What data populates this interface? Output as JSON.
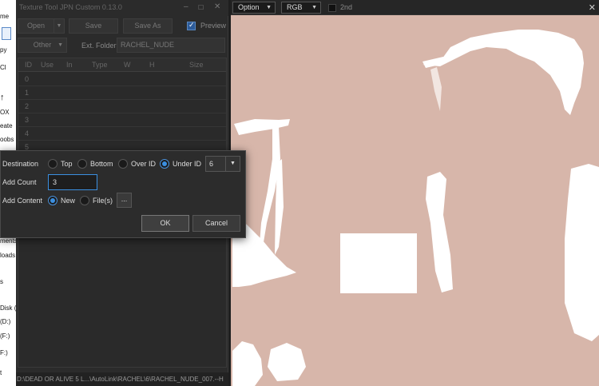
{
  "explorer": {
    "items": [
      "me",
      "py",
      "Cl",
      "↑",
      "OX",
      "eate",
      "oobs",
      "ments",
      "loads",
      "s",
      "Disk (",
      "(D:)",
      "(F:)",
      "F:)",
      "t"
    ]
  },
  "tool": {
    "title": "Texture Tool JPN Custom 0.13.0",
    "win_min": "–",
    "win_max": "☐",
    "win_close": "✕",
    "open_label": "Open",
    "open_arrow": "▼",
    "save_label": "Save",
    "saveas_label": "Save As",
    "preview_label": "Preview",
    "other_label": "Other",
    "other_arrow": "▼",
    "ext_folder_label": "Ext. Folder",
    "ext_folder_value": "RACHEL_NUDE",
    "columns": [
      "ID",
      "Use",
      "In",
      "Type",
      "W",
      "H",
      "Size"
    ],
    "rows": [
      "0",
      "1",
      "2",
      "3",
      "4",
      "5"
    ],
    "status_path": "D:\\DEAD OR ALIVE 5 L...\\AutoLink\\RACHEL\\6\\RACHEL_NUDE_007.--H"
  },
  "preview": {
    "option_label": "Option",
    "channel_label": "RGB",
    "second_label": "2nd",
    "close": "✕",
    "caret": "▼",
    "canvas_color": "#d7b6aa"
  },
  "dialog": {
    "destination_label": "Destination",
    "opt_top": "Top",
    "opt_bottom": "Bottom",
    "opt_over": "Over ID",
    "opt_under": "Under ID",
    "under_id_value": "6",
    "add_count_label": "Add Count",
    "add_count_value": "3",
    "add_content_label": "Add Content",
    "opt_new": "New",
    "opt_files": "File(s)",
    "browse_label": "...",
    "ok_label": "OK",
    "cancel_label": "Cancel",
    "caret": "▼"
  }
}
